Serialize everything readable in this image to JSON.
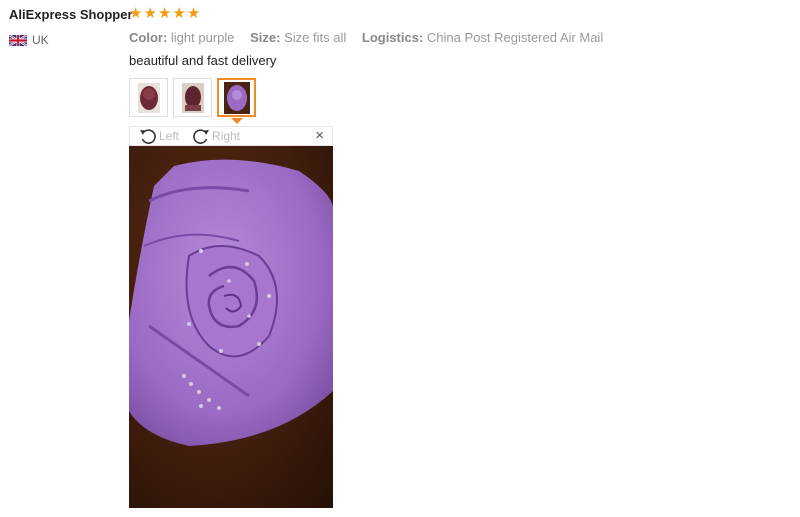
{
  "review": {
    "reviewer_name": "AliExpress Shopper",
    "rating": 5,
    "country": "UK",
    "attributes": [
      {
        "key": "Color:",
        "value": "light purple"
      },
      {
        "key": "Size:",
        "value": "Size fits all"
      },
      {
        "key": "Logistics:",
        "value": "China Post Registered Air Mail"
      }
    ],
    "text": "beautiful and fast delivery",
    "thumbnails": [
      {
        "selected": false
      },
      {
        "selected": false
      },
      {
        "selected": true
      }
    ]
  },
  "viewer": {
    "rotate_left_label": "Left",
    "rotate_right_label": "Right",
    "close_symbol": "×"
  },
  "colors": {
    "star": "#f39c12",
    "selected_border": "#f08a24",
    "fabric": "#9a6ac4",
    "background_wood": "#3e1c0c"
  }
}
